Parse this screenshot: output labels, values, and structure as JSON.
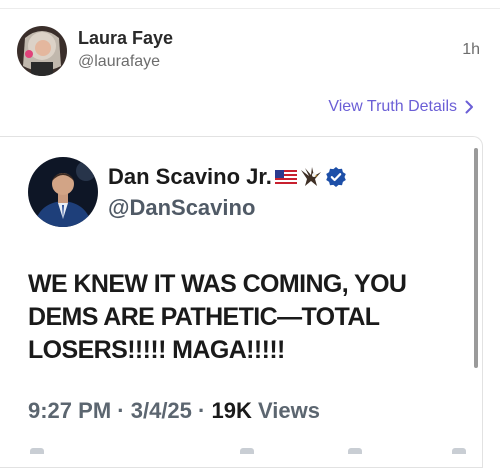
{
  "post": {
    "author_name": "Laura Faye",
    "author_handle": "@laurafaye",
    "timestamp": "1h",
    "view_details_label": "View Truth Details"
  },
  "embedded_truth": {
    "author_name": "Dan Scavino Jr.",
    "author_name_icons": [
      "us-flag-icon",
      "eagle-icon",
      "verified-badge-icon"
    ],
    "author_handle": "@DanScavino",
    "body": "WE KNEW IT WAS COMING, YOU DEMS ARE PATHETIC—TOTAL LOSERS!!!!! MAGA!!!!!",
    "time": "9:27 PM",
    "date": "3/4/25",
    "views_count": "19K",
    "views_label": "Views"
  },
  "colors": {
    "link": "#6b5fd6",
    "verified": "#1d4fa8",
    "secondary_text": "#6d6d6d"
  }
}
